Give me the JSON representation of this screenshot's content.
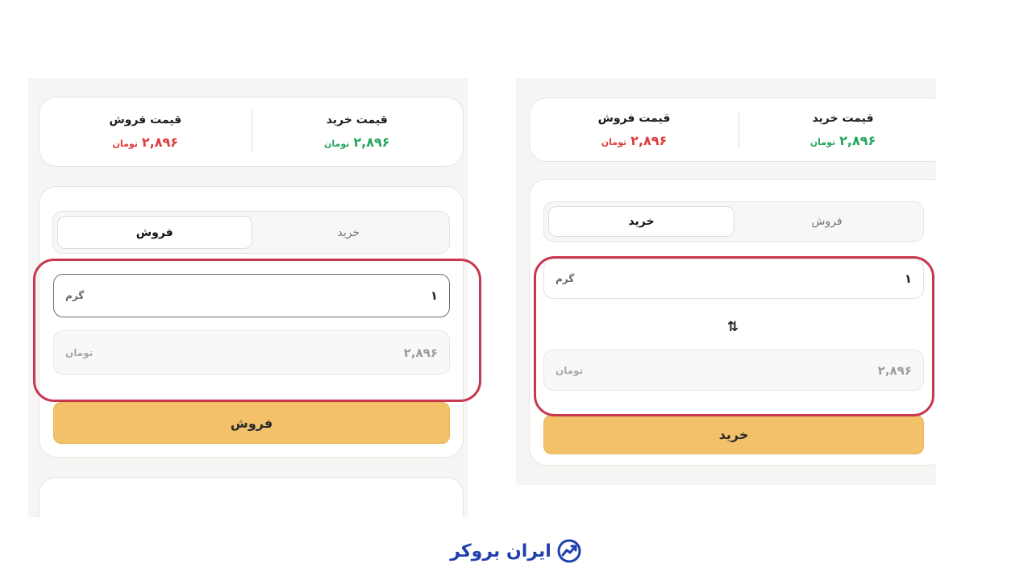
{
  "left": {
    "prices": {
      "buy_title": "قیمت خرید",
      "buy_value": "۲,۸۹۶",
      "buy_unit": "تومان",
      "sell_title": "قیمت فروش",
      "sell_value": "۲,۸۹۶",
      "sell_unit": "تومان"
    },
    "tabs": {
      "buy": "خرید",
      "sell": "فروش",
      "active": "sell"
    },
    "gram_field": {
      "value": "۱",
      "unit": "گرم"
    },
    "toman_field": {
      "value": "۲,۸۹۶",
      "unit": "تومان"
    },
    "submit_label": "فروش"
  },
  "right": {
    "prices": {
      "buy_title": "قیمت خرید",
      "buy_value": "۲,۸۹۶",
      "buy_unit": "تومان",
      "sell_title": "قیمت فروش",
      "sell_value": "۲,۸۹۶",
      "sell_unit": "تومان"
    },
    "tabs": {
      "buy": "خرید",
      "sell": "فروش",
      "active": "buy"
    },
    "gram_field": {
      "value": "۱",
      "unit": "گرم"
    },
    "swap_icon": "⇅",
    "toman_field": {
      "value": "۲,۸۹۶",
      "unit": "تومان"
    },
    "submit_label": "خرید"
  },
  "logo": {
    "text": "ایران بروکر"
  },
  "colors": {
    "buy_price": "#22a55a",
    "sell_price": "#e03a3a",
    "submit": "#f2c16a",
    "highlight": "#c8374f",
    "logo": "#1f3fae"
  }
}
